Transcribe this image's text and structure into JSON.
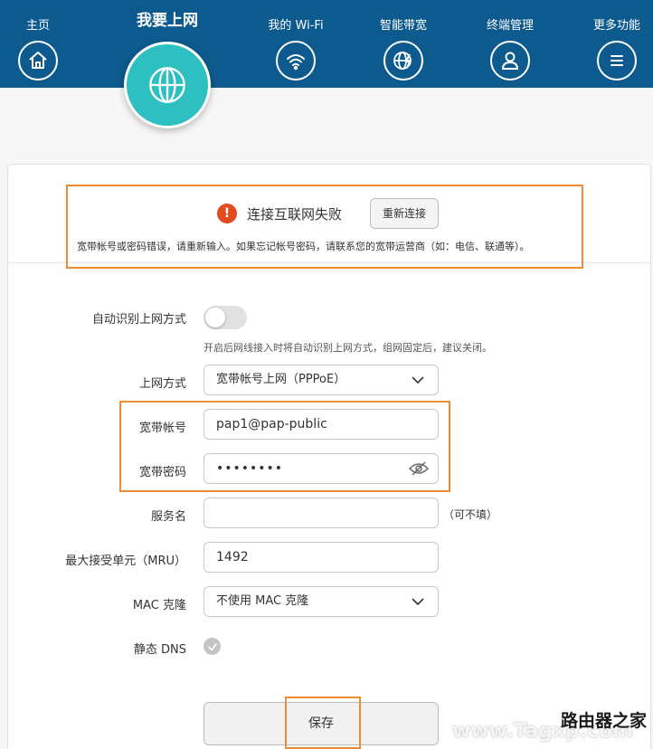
{
  "nav": {
    "items": [
      {
        "label": "主页",
        "icon": "home-icon"
      },
      {
        "label": "我的 Wi-Fi",
        "icon": "wifi-icon"
      },
      {
        "label": "智能带宽",
        "icon": "bandwidth-globe-icon"
      },
      {
        "label": "终端管理",
        "icon": "user-icon"
      },
      {
        "label": "更多功能",
        "icon": "menu-icon"
      }
    ],
    "active": {
      "label": "我要上网",
      "icon": "globe-icon"
    }
  },
  "colors": {
    "header": "#0d5a8e",
    "active": "#2ebfc0",
    "error": "#e04b1f",
    "highlight": "#ef8a35"
  },
  "error": {
    "icon": "!",
    "title": "连接互联网失败",
    "reconnect_label": "重新连接",
    "description": "宽带帐号或密码错误，请重新输入。如果忘记帐号密码，请联系您的宽带运营商（如：电信、联通等）。"
  },
  "form": {
    "auto_detect_label": "自动识别上网方式",
    "auto_detect_hint": "开启后网线接入时将自动识别上网方式，组网固定后，建议关闭。",
    "auto_detect_on": false,
    "mode_label": "上网方式",
    "mode_value": "宽带帐号上网（PPPoE）",
    "account_label": "宽带帐号",
    "account_value": "pap1@pap-public",
    "password_label": "宽带密码",
    "password_value": "••••••••",
    "service_label": "服务名",
    "service_value": "",
    "service_hint": "（可不填）",
    "mru_label": "最大接受单元（MRU）",
    "mru_value": "1492",
    "mac_label": "MAC 克隆",
    "mac_value": "不使用 MAC 克隆",
    "dns_label": "静态 DNS",
    "dns_checked": true,
    "save_label": "保存"
  },
  "watermark": {
    "top": "路由器之家",
    "bottom": "www.Tagxp.com"
  }
}
